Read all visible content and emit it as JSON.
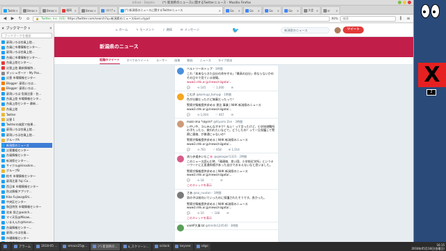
{
  "window": {
    "title": "(*) 新潟県のニュースに関するTwitterニュース - Mozilla Firefox",
    "bg_title": "bifrost - Dolphin"
  },
  "tabs": [
    {
      "label": "Twitter",
      "color": "#1da1f2"
    },
    {
      "label": "Bmoc",
      "color": "#888888"
    },
    {
      "label": "Bmoc",
      "color": "#888888"
    },
    {
      "label": "福岡",
      "color": "#e23a3a"
    },
    {
      "label": "Bmoc",
      "color": "#888888"
    },
    {
      "label": "コロナ",
      "color": "#4a8fdd"
    },
    {
      "label": "(*) 新潟県のニュースに関するTwitterニュース",
      "color": "#1da1f2",
      "active": true
    },
    {
      "label": "Go",
      "color": "#4285f4"
    },
    {
      "label": "Go",
      "color": "#4285f4"
    },
    {
      "label": "Go",
      "color": "#4285f4"
    },
    {
      "label": "Go",
      "color": "#4285f4"
    },
    {
      "label": "大会",
      "color": "#888888"
    },
    {
      "label": "sr",
      "color": "#888888"
    }
  ],
  "navbar": {
    "org": "Twitter, Inc. (US)",
    "url": "https://twitter.com/search?q=新潟県のニュース&src=typd",
    "zoom": "90%",
    "search_placeholder": "検索"
  },
  "sidebar": {
    "title": "ブックマーク",
    "search_placeholder": "ブックマークを検索",
    "items": [
      {
        "label": "豪雨いろは台風上陸...",
        "color": "#1da1f2"
      },
      {
        "label": "台風に市場情報センター...",
        "color": "#1da1f2"
      },
      {
        "label": "豪雨いろは台風上陸...",
        "color": "#1da1f2"
      },
      {
        "label": "台風に市場情報センター...",
        "color": "#1da1f2"
      },
      {
        "label": "台風上陸センター...",
        "color": "#e23a3a"
      },
      {
        "label": "災害上陸 最新情報特...",
        "color": "#e23a3a"
      },
      {
        "label": "ダッシュボード - My Pos...",
        "color": "#888888"
      },
      {
        "label": "災害 市場情報センター",
        "color": "#1da1f2"
      },
      {
        "label": "Blogger: 豪雨いろは...",
        "color": "#f57d00"
      },
      {
        "label": "Blogger: 豪雨いろは...",
        "color": "#f57d00"
      },
      {
        "label": "豪雨いろは 危険注意 - 台...",
        "color": "#1da1f2"
      },
      {
        "label": "台風上陸 市場情報センタ...",
        "color": "#1da1f2"
      },
      {
        "label": "台風上陸センター 最新...",
        "color": "#1da1f2"
      },
      {
        "label": "台風上陸",
        "color": "#e8b83a"
      },
      {
        "label": "Twitter",
        "color": "#e8b83a"
      },
      {
        "label": "災害 1",
        "color": "#e8b83a"
      },
      {
        "label": "Twitterの検索で結果...",
        "color": "#1da1f2"
      },
      {
        "label": "豪雨いろは台風上陸...",
        "color": "#1da1f2"
      },
      {
        "label": "豪雨いろは台風上陸...",
        "color": "#1da1f2"
      },
      {
        "label": "グループA",
        "color": "#e8b83a"
      },
      {
        "label": "新潟県のニュース",
        "color": "#1da1f2",
        "selected": true
      },
      {
        "label": "災害番組センター",
        "color": "#1da1f2"
      },
      {
        "label": "台風情報センター",
        "color": "#1da1f2"
      },
      {
        "label": "新潟県センター...",
        "color": "#1da1f2"
      },
      {
        "label": "サイクル@Hiroshim...",
        "color": "#1da1f2"
      },
      {
        "label": "グループB",
        "color": "#e8b83a"
      },
      {
        "label": "柏木 市場情報センター",
        "color": "#1da1f2"
      },
      {
        "label": "豪雨注意 Yuji Co...",
        "color": "#1da1f2"
      },
      {
        "label": "西日本 市場情報センター",
        "color": "#1da1f2"
      },
      {
        "label": "防災情報アプリケ...",
        "color": "#1da1f2"
      },
      {
        "label": "Kiko Fujiwa@Shi...",
        "color": "#1da1f2"
      },
      {
        "label": "中央区センター",
        "color": "#1da1f2"
      },
      {
        "label": "和田特別 市場情報センター",
        "color": "#1da1f2"
      },
      {
        "label": "池本 保之@aotch...",
        "color": "#1da1f2"
      },
      {
        "label": "マイ天気@Misaw...",
        "color": "#1da1f2"
      },
      {
        "label": "いまえんわ@harun...",
        "color": "#1da1f2"
      },
      {
        "label": "台風情報センター...",
        "color": "#1da1f2"
      },
      {
        "label": "豪雨いろは台風...",
        "color": "#1da1f2"
      },
      {
        "label": "市場情報センター",
        "color": "#1da1f2"
      },
      {
        "label": "台風情報センター",
        "color": "#1da1f2"
      }
    ]
  },
  "twitter": {
    "nav": [
      "ホーム",
      "モーメント",
      "通知",
      "メッセージ"
    ],
    "search_value": "新潟県のニュース",
    "tweet_button": "ツイート",
    "banner_title": "新潟県のニュース",
    "subnav": [
      "話題のツイート",
      "すべてのツイート",
      "ユーザー",
      "画像",
      "動画",
      "ニュース",
      "ライブ放送"
    ],
    "tweets": [
      {
        "name": "ベルトリーのトップ",
        "handle": "· 1時間",
        "text": "これ「本来ならきた自分の命を守る」「最高の自分」命ならないかのその日々で見ている現場。",
        "link": "www3.nhk.or.jp/news/niigata/...",
        "stats": [
          "",
          "145",
          "1,000",
          ""
        ],
        "color": "#4a8fdd"
      },
      {
        "name": "こむぎ",
        "handle": "@komugi_tomugi · 1時間",
        "text": "色が分類だったけど無事だったって！",
        "link": "",
        "stats": [
          "",
          "1,004",
          "467",
          ""
        ],
        "color": "#f5a623",
        "quote": "警察が情報提供求める 恵比 事業 | NHK 新潟県のニュース www3.nhk.or.jp/news/niigata/..."
      },
      {
        "name": "maki-ima *skyrm*",
        "handle": "@Kiyomi Zen · 3時間",
        "text": "いやいや、コレみんなオタク？ねぇ！って言ったけど、小学校避難所の子たったら、救われたいなどて。どうしたの？って一旦保護して警察に連絡、が普通じゃないの？",
        "link": "",
        "stats": [
          "",
          "781",
          "858",
          "1,014"
        ],
        "color": "#cc9b7a",
        "quote": "警察が情報提供求める | NHK 新潟県のニュース www3.nhk.or.jp/news/niigata/..."
      },
      {
        "name": "流ら歩道歩いもこ🌸",
        "handle": "@gakogari1323 · 2時間",
        "text": "このニュース読んだ時、「親連絡、良い国、小学校近学所」というキーワードに正直違和感があった自分でおるえないなと思いました。",
        "link": "",
        "stats": [
          "",
          "18",
          "",
          ""
        ],
        "color": "#d65c8a",
        "quote": "警察が情報提供求める | NHK 新潟県のニュース www3.nhk.or.jp/news/niigata/...",
        "thread": "このスレッドを表示"
      },
      {
        "name": "さあ",
        "handle": "@sa_nuuton · 1時間",
        "text": "男の子は前向いていったのに保護されたそうです。良かった。",
        "link": "",
        "stats": [
          "",
          "10",
          "148",
          ""
        ],
        "color": "#7a7a7a",
        "quote": "警察が情報提供求める | NHK 新潟県のニュース www3.nhk.or.jp/news/niigata/...",
        "thread": "このスレッドを表示"
      },
      {
        "name": "vieHP大事 bt",
        "handle": "@hmi0s124540 · 3時間",
        "text": "",
        "link": "",
        "stats": [],
        "color": "#5a9f5a"
      }
    ]
  },
  "taskbar": {
    "items": [
      "",
      "アラーム",
      "2018-05 ...",
      "emacs25@...",
      "(*) 新潟県の...",
      "a_スクリーン...",
      "scilack",
      "keyvee",
      "sdgo"
    ],
    "clock_time": "16:15",
    "clock_date": "2018年05月18日(金曜日)"
  },
  "right_panel": {
    "badge": "2"
  }
}
